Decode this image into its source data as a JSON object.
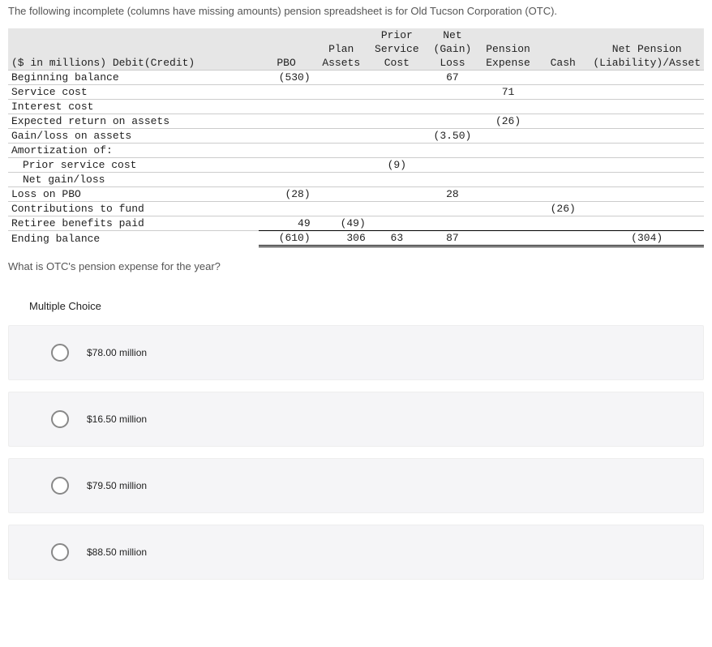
{
  "intro": "The following incomplete (columns have missing amounts) pension spreadsheet is for Old Tucson Corporation (OTC).",
  "headers": {
    "row1": [
      "",
      "",
      "",
      "Prior",
      "Net",
      "",
      "",
      ""
    ],
    "row2": [
      "",
      "",
      "Plan",
      "Service",
      "(Gain)",
      "Pension",
      "",
      "Net Pension"
    ],
    "row3": [
      "($ in millions) Debit(Credit)",
      "PBO",
      "Assets",
      "Cost",
      "Loss",
      "Expense",
      "Cash",
      "(Liability)/Asset"
    ]
  },
  "rows": [
    {
      "label": "Beginning balance",
      "pbo": "(530)",
      "plan": "",
      "prior": "",
      "net": "67",
      "pension": "",
      "cash": "",
      "liab": ""
    },
    {
      "label": "Service cost",
      "pbo": "",
      "plan": "",
      "prior": "",
      "net": "",
      "pension": "71",
      "cash": "",
      "liab": ""
    },
    {
      "label": "Interest cost",
      "pbo": "",
      "plan": "",
      "prior": "",
      "net": "",
      "pension": "",
      "cash": "",
      "liab": ""
    },
    {
      "label": "Expected return on assets",
      "pbo": "",
      "plan": "",
      "prior": "",
      "net": "",
      "pension": "(26)",
      "cash": "",
      "liab": ""
    },
    {
      "label": "Gain/loss on assets",
      "pbo": "",
      "plan": "",
      "prior": "",
      "net": "(3.50)",
      "pension": "",
      "cash": "",
      "liab": ""
    },
    {
      "label": "Amortization of:",
      "pbo": "",
      "plan": "",
      "prior": "",
      "net": "",
      "pension": "",
      "cash": "",
      "liab": ""
    },
    {
      "label": "Prior service cost",
      "indent": true,
      "pbo": "",
      "plan": "",
      "prior": "(9)",
      "net": "",
      "pension": "",
      "cash": "",
      "liab": ""
    },
    {
      "label": "Net gain/loss",
      "indent": true,
      "pbo": "",
      "plan": "",
      "prior": "",
      "net": "",
      "pension": "",
      "cash": "",
      "liab": ""
    },
    {
      "label": "Loss on PBO",
      "pbo": "(28)",
      "plan": "",
      "prior": "",
      "net": "28",
      "pension": "",
      "cash": "",
      "liab": ""
    },
    {
      "label": "Contributions to fund",
      "pbo": "",
      "plan": "",
      "prior": "",
      "net": "",
      "pension": "",
      "cash": "(26)",
      "liab": ""
    },
    {
      "label": "Retiree benefits paid",
      "pbo": "49",
      "plan": "(49)",
      "prior": "",
      "net": "",
      "pension": "",
      "cash": "",
      "liab": ""
    }
  ],
  "ending": {
    "label": "Ending balance",
    "pbo": "(610)",
    "plan": "306",
    "prior": "63",
    "net": "87",
    "pension": "",
    "cash": "",
    "liab": "(304)"
  },
  "question": "What is OTC's pension expense for the year?",
  "mc_label": "Multiple Choice",
  "options": [
    "$78.00 million",
    "$16.50 million",
    "$79.50 million",
    "$88.50 million"
  ]
}
